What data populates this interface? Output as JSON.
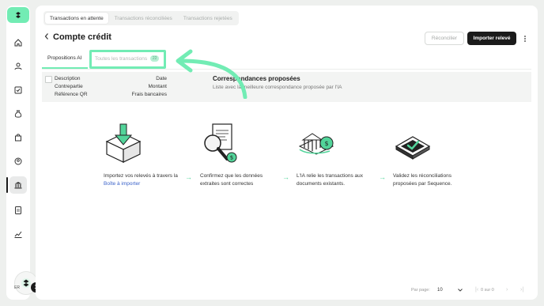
{
  "sidebar": {
    "logo": "sequence-logo",
    "items": [
      {
        "icon": "home-icon"
      },
      {
        "icon": "users-icon"
      },
      {
        "icon": "checkbox-icon"
      },
      {
        "icon": "money-bag-icon"
      },
      {
        "icon": "shopping-bag-icon"
      },
      {
        "icon": "user-circle-icon"
      },
      {
        "icon": "bank-icon",
        "active": true
      },
      {
        "icon": "document-icon"
      },
      {
        "icon": "chart-icon"
      }
    ],
    "user": {
      "initials": "ER",
      "notifications": "1"
    }
  },
  "top_tabs": [
    {
      "label": "Transactions en attente",
      "active": true
    },
    {
      "label": "Transactions réconciliées"
    },
    {
      "label": "Transactions rejetées"
    }
  ],
  "header": {
    "back_icon": "chevron-left-icon",
    "title": "Compte crédit",
    "reconcile_label": "Réconcilier",
    "import_label": "Importer relevé"
  },
  "sub_tabs": {
    "ai_label": "Propositions AI",
    "all_label": "Toutes les transactions",
    "all_count": "22"
  },
  "list": {
    "left_col": [
      "Description",
      "Contrepartie",
      "Référence QR"
    ],
    "right_col": [
      "Date",
      "Montant",
      "Frais bancaires"
    ],
    "match_title": "Correspondances proposées",
    "match_subtitle": "Liste avec la meilleure correspondance proposée par l'IA"
  },
  "steps": [
    {
      "icon": "download-box-icon",
      "text": "Importez vos relevés à travers la",
      "link": "Boîte à importer"
    },
    {
      "icon": "magnifier-document-icon",
      "text": "Confirmez que les données extraites sont correctes"
    },
    {
      "icon": "bank-coin-icon",
      "text": "L'IA relie les transactions aux documents existants."
    },
    {
      "icon": "validate-icon",
      "text": "Validez les réconciliations proposées par Sequence."
    }
  ],
  "pagination": {
    "per_page_label": "Par page:",
    "per_page_value": "10",
    "count": "0 sur 0"
  },
  "colors": {
    "accent": "#72ecb4",
    "dark": "#1b1b1b",
    "link": "#3a62c9"
  }
}
